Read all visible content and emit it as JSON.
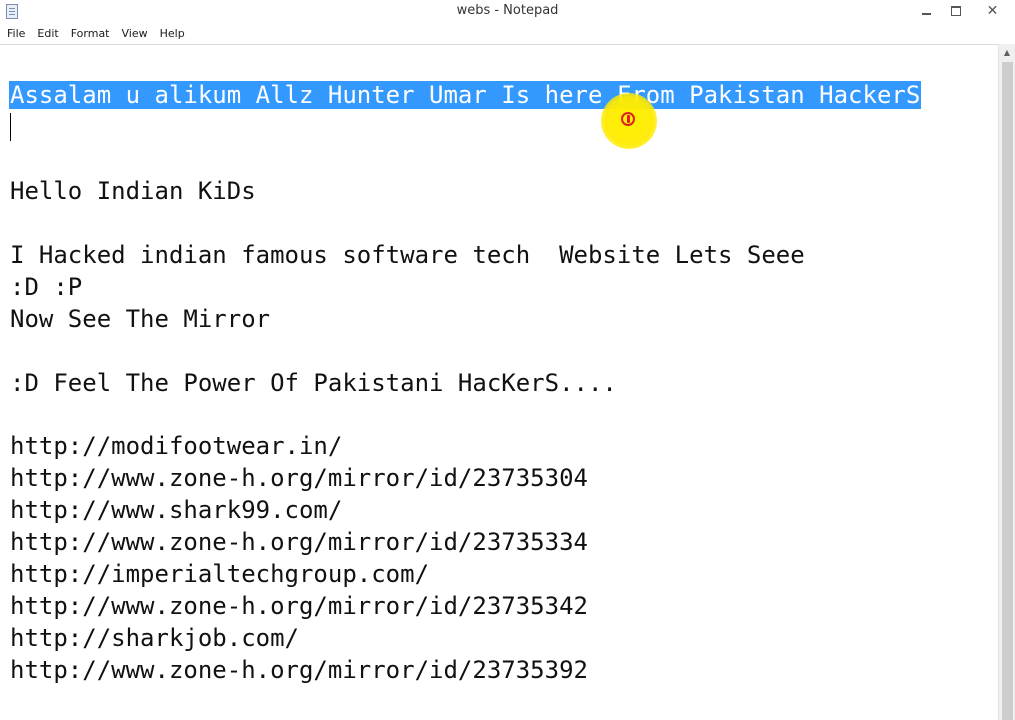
{
  "window": {
    "title": "webs - Notepad",
    "minimize_glyph": "",
    "maximize_glyph": "",
    "close_glyph": "✕"
  },
  "menu": {
    "items": [
      {
        "label": "File"
      },
      {
        "label": "Edit"
      },
      {
        "label": "Format"
      },
      {
        "label": "View"
      },
      {
        "label": "Help"
      }
    ]
  },
  "editor": {
    "lines": [
      "Assalam u alikum Allz Hunter Umar Is here From Pakistan HackerS",
      "",
      "",
      "Hello Indian KiDs",
      "",
      "I Hacked indian famous software tech  Website Lets Seee",
      ":D :P",
      "Now See The Mirror",
      "",
      ":D Feel The Power Of Pakistani HacKerS....",
      "",
      "http://modifootwear.in/",
      "http://www.zone-h.org/mirror/id/23735304",
      "http://www.shark99.com/",
      "http://www.zone-h.org/mirror/id/23735334",
      "http://imperialtechgroup.com/",
      "http://www.zone-h.org/mirror/id/23735342",
      "http://sharkjob.com/",
      "http://www.zone-h.org/mirror/id/23735392"
    ],
    "selected_line_index": 0
  },
  "scrollbar": {
    "up_arrow": "▲"
  },
  "colors": {
    "selection": "#3399ff",
    "cursor_highlight": "#ffeb00",
    "cursor_icon": "#e02020"
  },
  "icons": {
    "app": "notepad-icon",
    "cursor": "mouse-cursor-icon"
  }
}
